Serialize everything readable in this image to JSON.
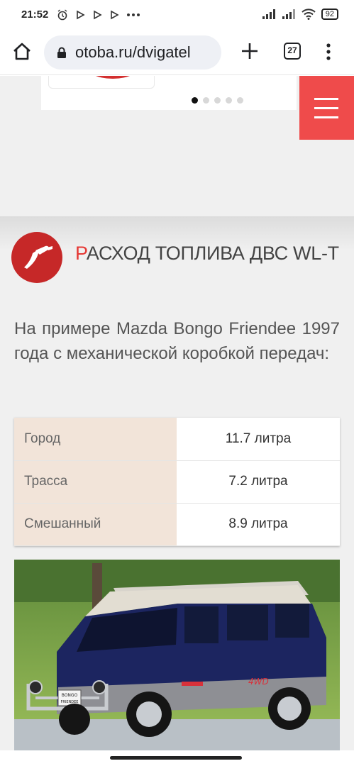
{
  "status_bar": {
    "time": "21:52",
    "battery": "92",
    "notification_icons": [
      "alarm-icon",
      "play-icon",
      "play-icon",
      "play-icon",
      "more-icon"
    ]
  },
  "browser": {
    "url": "otoba.ru/dvigatel",
    "tab_count": "27"
  },
  "slider": {
    "dots_total": 5,
    "active_index": 0
  },
  "section": {
    "title_first_letter": "Р",
    "title_rest": "АСХОД ТОПЛИВА ДВС WL-T",
    "icon": "fuel-pump-icon"
  },
  "intro_text": "На примере Mazda Bongo Friendee 1997 года с механической коробкой передач:",
  "fuel_table": {
    "rows": [
      {
        "label": "Город",
        "value": "11.7 литра"
      },
      {
        "label": "Трасса",
        "value": "7.2 литра"
      },
      {
        "label": "Смешанный",
        "value": "8.9 литра"
      }
    ]
  },
  "photo": {
    "plate_line1": "BONGO",
    "plate_line2": "FRIENDEE",
    "badge": "4WD"
  },
  "colors": {
    "accent": "#ef4b4b",
    "table_label_bg": "#f2e4d9"
  }
}
